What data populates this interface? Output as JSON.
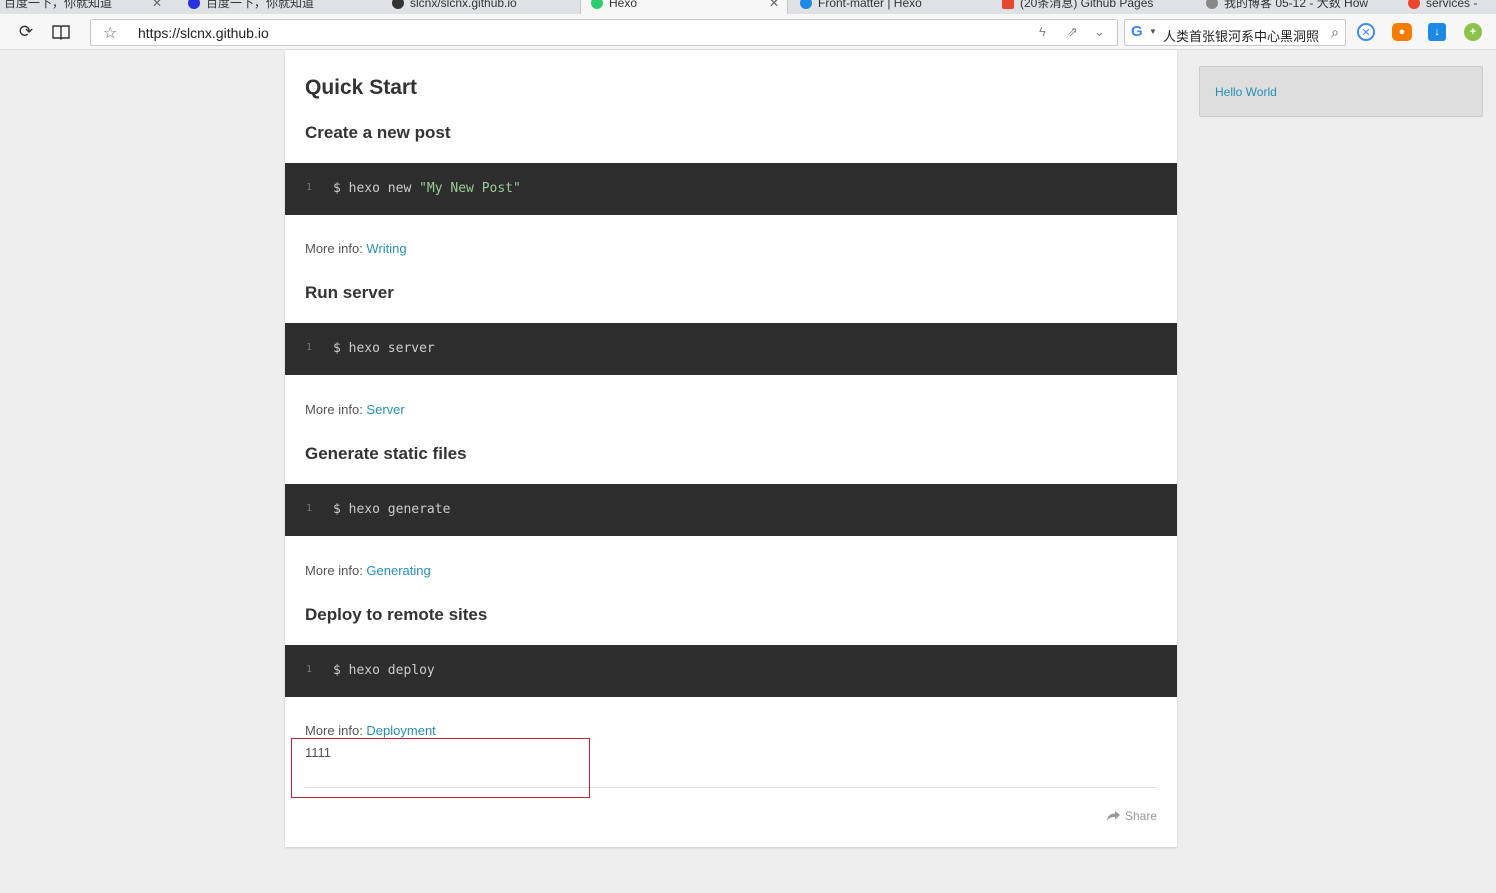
{
  "browser": {
    "tabs": [
      {
        "label": "百度一下，你就知道"
      },
      {
        "label": "百度一下，你就知道"
      },
      {
        "label": "slcnx/slcnx.github.io"
      },
      {
        "label": "Hexo"
      },
      {
        "label": "Front-matter | Hexo"
      },
      {
        "label": "(20条消息) Github Pages"
      },
      {
        "label": "我的博客 05-12 - 大数 How"
      },
      {
        "label": "services -"
      }
    ],
    "address": {
      "url": "https://slcnx.github.io"
    },
    "search": {
      "query": "人类首张银河系中心黑洞照"
    }
  },
  "article": {
    "title": "Quick Start",
    "sections": [
      {
        "heading": "Create a new post",
        "line_no": "1",
        "cmd": "$ hexo new ",
        "cmd_str": "\"My New Post\"",
        "info_prefix": "More info: ",
        "info_link": "Writing"
      },
      {
        "heading": "Run server",
        "line_no": "1",
        "cmd": "$ hexo server",
        "cmd_str": "",
        "info_prefix": "More info: ",
        "info_link": "Server"
      },
      {
        "heading": "Generate static files",
        "line_no": "1",
        "cmd": "$ hexo generate",
        "cmd_str": "",
        "info_prefix": "More info: ",
        "info_link": "Generating"
      },
      {
        "heading": "Deploy to remote sites",
        "line_no": "1",
        "cmd": "$ hexo deploy",
        "cmd_str": "",
        "info_prefix": "More info: ",
        "info_link": "Deployment"
      }
    ],
    "extra_text": "1111",
    "share_label": "Share"
  },
  "sidebar": {
    "recent_posts": [
      {
        "label": "Hello World"
      }
    ]
  },
  "colors": {
    "link": "#258fb8",
    "code_bg": "#2d2d2d",
    "highlight_border": "#c4242f"
  }
}
